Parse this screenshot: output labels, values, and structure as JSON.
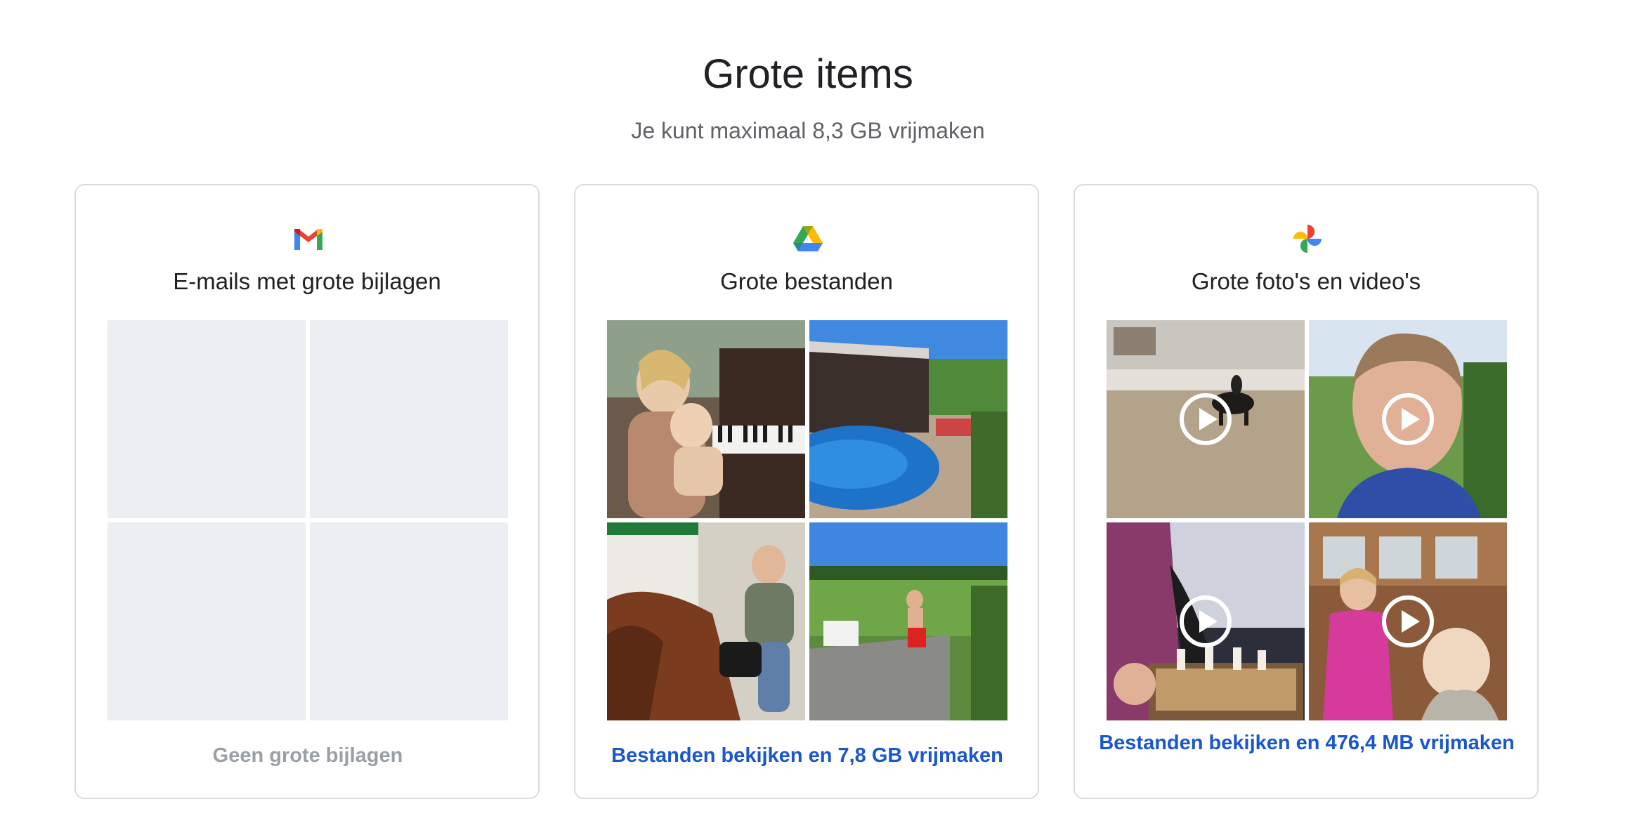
{
  "header": {
    "title": "Grote items",
    "subtitle": "Je kunt maximaal 8,3 GB vrijmaken"
  },
  "cards": [
    {
      "icon": "gmail-icon",
      "title": "E-mails met grote bijlagen",
      "footer": "Geen grote bijlagen",
      "footer_state": "disabled"
    },
    {
      "icon": "google-drive-icon",
      "title": "Grote bestanden",
      "footer": "Bestanden bekijken en 7,8 GB vrijmaken",
      "footer_state": "link"
    },
    {
      "icon": "google-photos-icon",
      "title": "Grote foto's en video's",
      "footer": "Bestanden bekijken en 476,4 MB vrijmaken",
      "footer_state": "link"
    }
  ],
  "colors": {
    "link": "#1a56cc",
    "muted": "#9aa0a6",
    "placeholder": "#eceff1",
    "border": "#dadce0"
  }
}
